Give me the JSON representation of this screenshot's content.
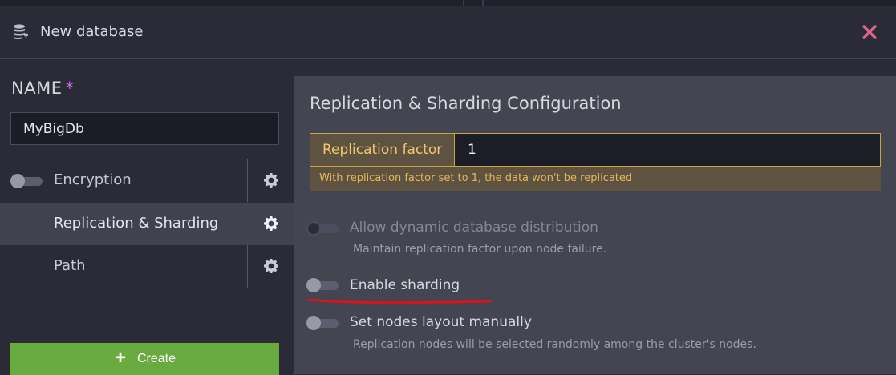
{
  "header": {
    "title": "New database",
    "icon": "database-add-icon",
    "close_icon": "close-icon",
    "close_color": "#e06482"
  },
  "left_panel": {
    "name_label": "NAME",
    "required_mark": "*",
    "name_value": "MyBigDb",
    "menu": [
      {
        "label": "Encryption",
        "toggle": false,
        "icon": "gear-icon",
        "active": false
      },
      {
        "label": "Replication & Sharding",
        "icon": "gear-icon",
        "active": true
      },
      {
        "label": "Path",
        "icon": "gear-icon",
        "active": false
      }
    ],
    "create_button": {
      "label": "Create",
      "icon": "plus-icon",
      "color": "#6aab3f"
    }
  },
  "right_panel": {
    "heading": "Replication & Sharding Configuration",
    "replication_factor": {
      "label": "Replication factor",
      "value": "1",
      "warning": "With replication factor set to 1, the data won't be replicated"
    },
    "options": [
      {
        "title": "Allow dynamic database distribution",
        "description": "Maintain replication factor upon node failure.",
        "enabled": false,
        "disabled": true
      },
      {
        "title": "Enable sharding",
        "description": "",
        "enabled": false,
        "disabled": false
      },
      {
        "title": "Set nodes layout manually",
        "description": "Replication nodes will be selected randomly among the cluster's nodes.",
        "enabled": false,
        "disabled": false
      }
    ]
  },
  "colors": {
    "accent_warning": "#e9b658",
    "annotation_red": "#d8131b"
  }
}
